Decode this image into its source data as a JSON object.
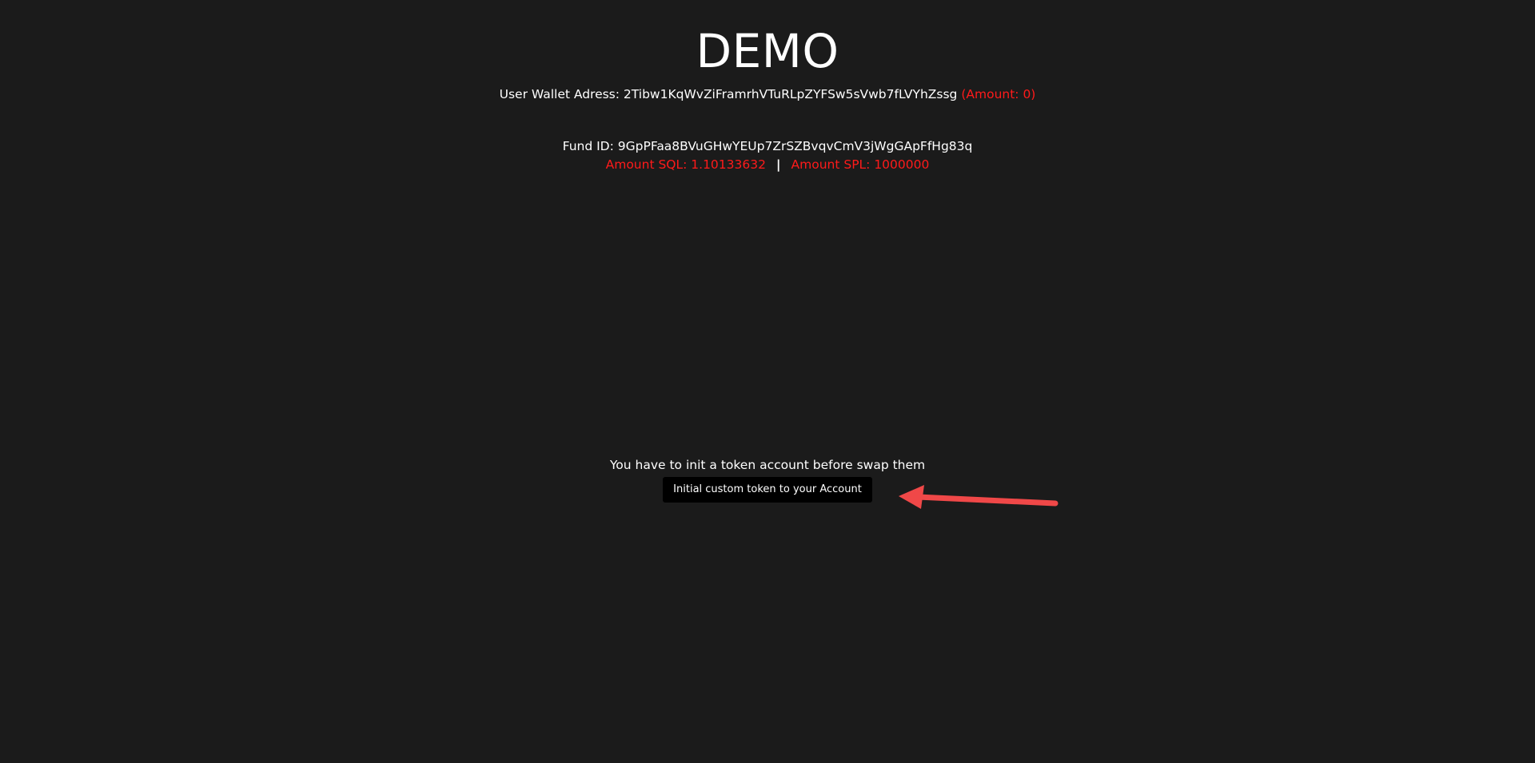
{
  "header": {
    "title": "DEMO"
  },
  "wallet": {
    "label": "User Wallet Adress: 2Tibw1KqWvZiFramrhVTuRLpZYFSw5sVwb7fLVYhZssg",
    "amount": "(Amount: 0)"
  },
  "fund": {
    "id_text": "Fund ID: 9GpPFaa8BVuGHwYEUp7ZrSZBvqvCmV3jWgGApFfHg83q",
    "amount_sql": "Amount SQL: 1.10133632",
    "separator": "|",
    "amount_spl": "Amount SPL: 1000000"
  },
  "init": {
    "message": "You have to init a token account before swap them",
    "button_label": "Initial custom token to your Account"
  },
  "colors": {
    "background": "#1b1b1b",
    "accent_red": "#ff1a1a",
    "arrow_red": "#f04848",
    "button_bg": "#000000"
  }
}
